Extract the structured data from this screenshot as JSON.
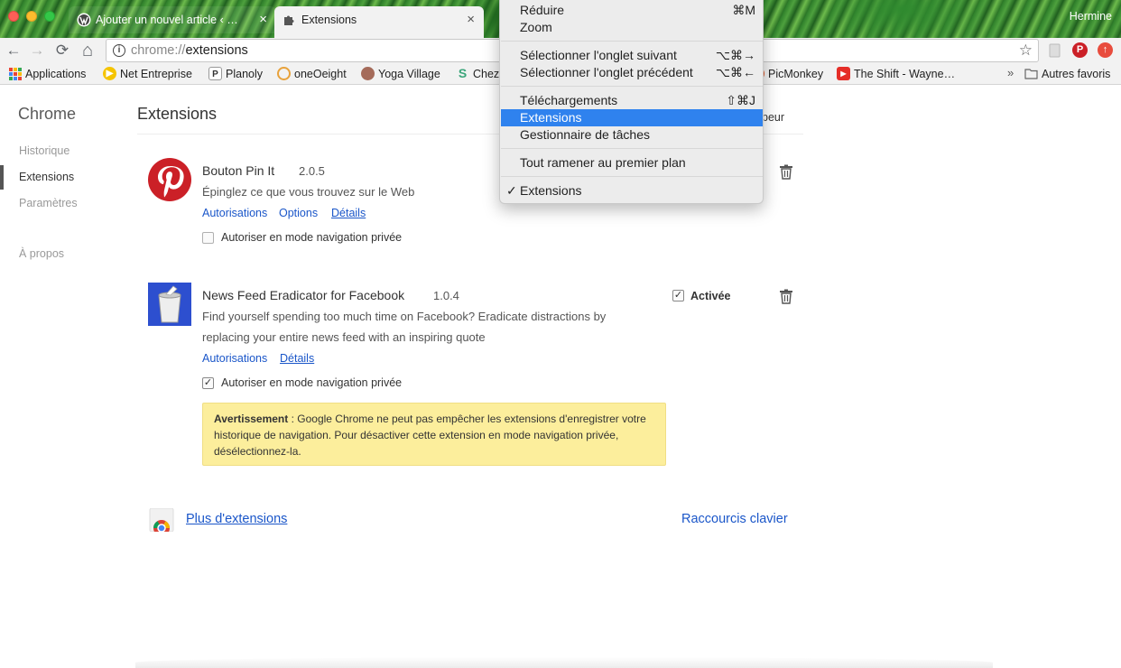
{
  "window": {
    "profile_name": "Hermine"
  },
  "tabs": [
    {
      "title": "Ajouter un nouvel article ‹ Hermine",
      "close": "×"
    },
    {
      "title": "Extensions",
      "close": "×"
    }
  ],
  "toolbar": {
    "back": "←",
    "forward": "→",
    "reload": "⟳",
    "home": "⌂",
    "url_scheme": "chrome://",
    "url_host": "extensions",
    "info_glyph": "i",
    "bookmark_star": "☆"
  },
  "bookmarks": {
    "items": [
      {
        "label": "Applications",
        "icon": "apps-grid-icon"
      },
      {
        "label": "Net Entreprise",
        "icon": "play-icon"
      },
      {
        "label": "Planoly",
        "icon": "planoly-icon",
        "glyph": "P"
      },
      {
        "label": "oneOeight",
        "icon": "ring-icon"
      },
      {
        "label": "Yoga Village",
        "icon": "yoga-icon"
      },
      {
        "label": "Chez",
        "icon": "dollar-icon",
        "glyph": "S"
      },
      {
        "label": "PicMonkey",
        "icon": "picmonkey-icon"
      },
      {
        "label": "The Shift - Wayne…",
        "icon": "youtube-icon"
      },
      {
        "label": "Autres favoris",
        "icon": "folder-icon"
      }
    ],
    "overflow": "»"
  },
  "sidebar": {
    "title": "Chrome",
    "items": [
      {
        "label": "Historique",
        "active": false
      },
      {
        "label": "Extensions",
        "active": true
      },
      {
        "label": "Paramètres",
        "active": false
      },
      {
        "label": "À propos",
        "active": false
      }
    ]
  },
  "page": {
    "title": "Extensions",
    "dev_mode_label": "peur"
  },
  "extensions": [
    {
      "name": "Bouton Pin It",
      "version": "2.0.5",
      "description": "Épinglez ce que vous trouvez sur le Web",
      "links": [
        "Autorisations",
        "Options",
        "Détails"
      ],
      "incognito_label": "Autoriser en mode navigation privée",
      "incognito_checked": false
    },
    {
      "name": "News Feed Eradicator for Facebook",
      "version": "1.0.4",
      "description_line1": "Find yourself spending too much time on Facebook? Eradicate distractions by",
      "description_line2": "replacing your entire news feed with an inspiring quote",
      "links": [
        "Autorisations",
        "Détails"
      ],
      "enabled_label": "Activée",
      "enabled": true,
      "incognito_label": "Autoriser en mode navigation privée",
      "incognito_checked": true,
      "warning_title": "Avertissement",
      "warning_text": " : Google Chrome ne peut pas empêcher les extensions d'enregistrer votre historique de navigation. Pour désactiver cette extension en mode navigation privée, désélectionnez-la."
    }
  ],
  "footer": {
    "more_extensions": "Plus d'extensions",
    "keyboard_shortcuts": "Raccourcis clavier"
  },
  "menu": {
    "items": [
      {
        "label": "Réduire",
        "shortcut": "⌘M"
      },
      {
        "label": "Zoom",
        "shortcut": ""
      },
      {
        "label": "Sélectionner l'onglet suivant",
        "shortcut": "⌥⌘→"
      },
      {
        "label": "Sélectionner l'onglet précédent",
        "shortcut": "⌥⌘←"
      },
      {
        "label": "Téléchargements",
        "shortcut": "⇧⌘J"
      },
      {
        "label": "Extensions",
        "shortcut": "",
        "selected": true
      },
      {
        "label": "Gestionnaire de tâches",
        "shortcut": ""
      },
      {
        "label": "Tout ramener au premier plan",
        "shortcut": ""
      },
      {
        "label": "Extensions",
        "shortcut": "",
        "checked": true,
        "check": "✓"
      }
    ]
  },
  "colors": {
    "link": "#1a56c9",
    "menu_highlight": "#2f82ee",
    "warning_bg": "#fcee9c",
    "pinterest_red": "#cb2027"
  }
}
